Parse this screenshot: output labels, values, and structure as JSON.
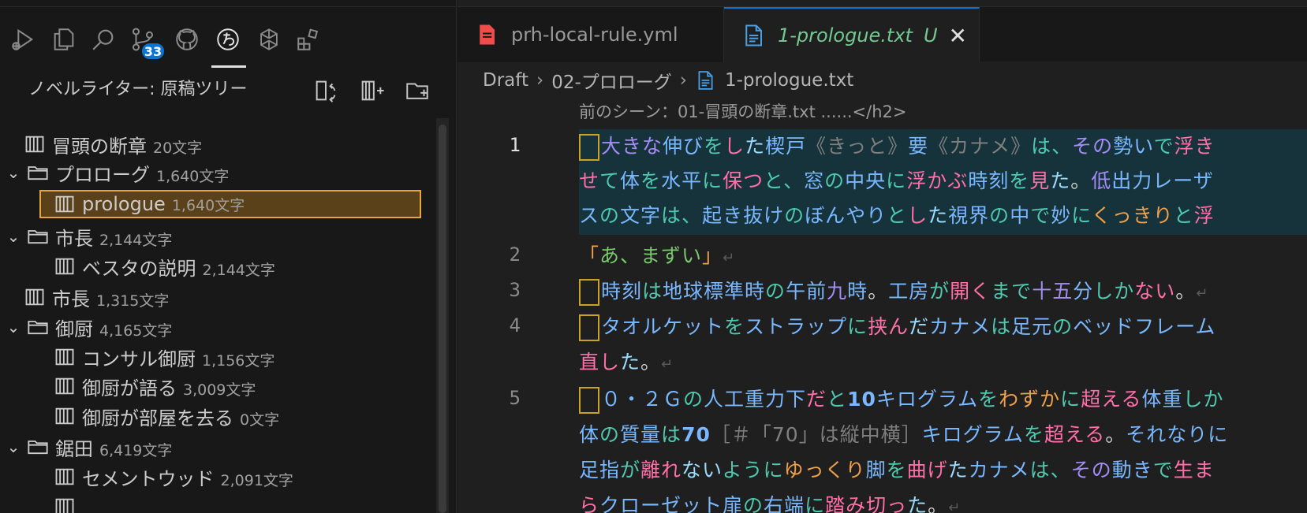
{
  "activity_bar": {
    "icons": [
      "run-debug-icon",
      "explorer-icon",
      "search-icon",
      "source-control-icon",
      "github-icon",
      "novel-writer-icon",
      "openai-icon",
      "extensions-icon"
    ],
    "source_control_badge": "33"
  },
  "sidebar": {
    "title": "ノベルライター: 原稿ツリー",
    "tree": [
      {
        "label": "冒頭の断章",
        "count": "20文字",
        "type": "file",
        "depth": 0
      },
      {
        "label": "プロローグ",
        "count": "1,640文字",
        "type": "folder",
        "depth": 0
      },
      {
        "label": "prologue",
        "count": "1,640文字",
        "type": "file",
        "depth": 1,
        "selected": true
      },
      {
        "label": "市長",
        "count": "2,144文字",
        "type": "folder",
        "depth": 0
      },
      {
        "label": "ベスタの説明",
        "count": "2,144文字",
        "type": "file",
        "depth": 1
      },
      {
        "label": "市長",
        "count": "1,315文字",
        "type": "file",
        "depth": 0
      },
      {
        "label": "御厨",
        "count": "4,165文字",
        "type": "folder",
        "depth": 0
      },
      {
        "label": "コンサル御厨",
        "count": "1,156文字",
        "type": "file",
        "depth": 1
      },
      {
        "label": "御厨が語る",
        "count": "3,009文字",
        "type": "file",
        "depth": 1
      },
      {
        "label": "御厨が部屋を去る",
        "count": "0文字",
        "type": "file",
        "depth": 1
      },
      {
        "label": "鋸田",
        "count": "6,419文字",
        "type": "folder",
        "depth": 0
      },
      {
        "label": "セメントウッド",
        "count": "2,091文字",
        "type": "file",
        "depth": 1
      }
    ]
  },
  "tabs": [
    {
      "label": "prh-local-rule.yml",
      "active": false
    },
    {
      "label": "1-prologue.txt",
      "status": "U",
      "active": true
    }
  ],
  "breadcrumb": [
    "Draft",
    "02-プロローグ",
    "1-prologue.txt"
  ],
  "editor": {
    "prev_scene": "前のシーン：01-冒頭の断章.txt ......</h2>",
    "line_numbers": [
      "1",
      "2",
      "3",
      "4",
      "5"
    ]
  }
}
